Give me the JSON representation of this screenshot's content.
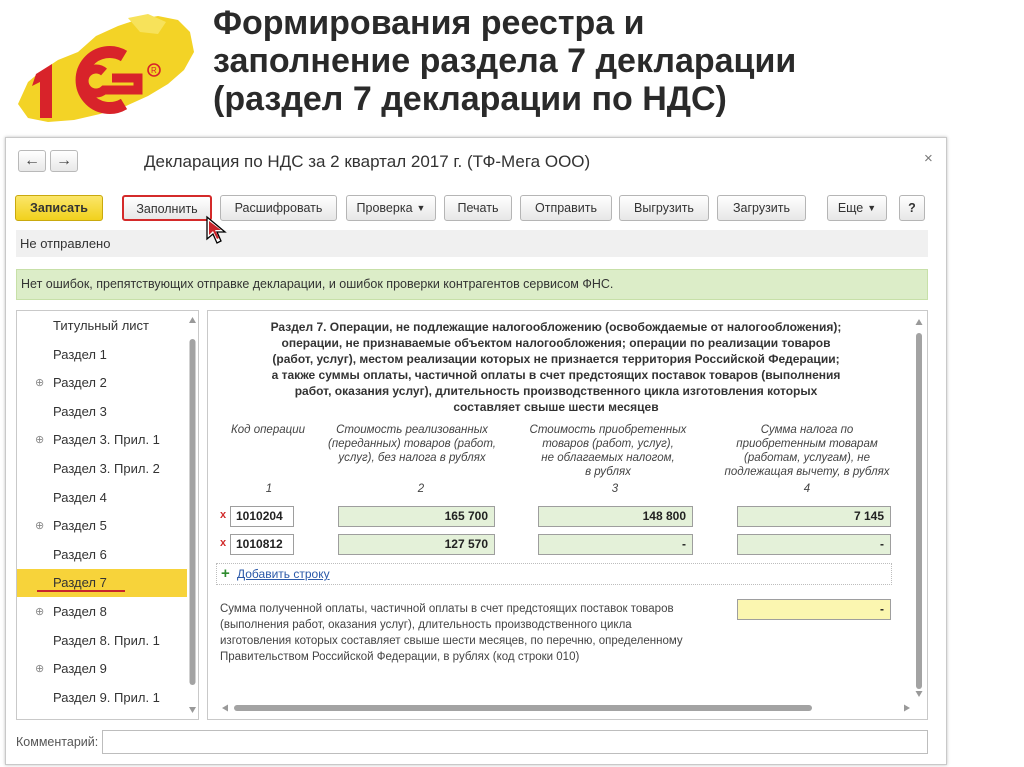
{
  "slide": {
    "title_lines": [
      "Формирования реестра и",
      "заполнение раздела 7 декларации",
      "(раздел 7 декларации по НДС)"
    ],
    "logo_text": "1С"
  },
  "window": {
    "title": "Декларация по НДС за 2 квартал 2017 г. (ТФ-Мега ООО)",
    "nav_back": "←",
    "nav_forward": "→",
    "close": "×"
  },
  "toolbar": {
    "save": "Записать",
    "fill": "Заполнить",
    "decode": "Расшифровать",
    "check": "Проверка",
    "print": "Печать",
    "send": "Отправить",
    "export": "Выгрузить",
    "import": "Загрузить",
    "more": "Еще",
    "help": "?"
  },
  "status": "Не отправлено",
  "info": "Нет ошибок, препятствующих отправке декларации, и ошибок проверки контрагентов сервисом ФНС.",
  "sidebar": {
    "items": [
      {
        "label": "Титульный лист",
        "expandable": false
      },
      {
        "label": "Раздел 1",
        "expandable": false
      },
      {
        "label": "Раздел 2",
        "expandable": true
      },
      {
        "label": "Раздел 3",
        "expandable": false
      },
      {
        "label": "Раздел 3. Прил. 1",
        "expandable": true
      },
      {
        "label": "Раздел 3. Прил. 2",
        "expandable": false
      },
      {
        "label": "Раздел 4",
        "expandable": false
      },
      {
        "label": "Раздел 5",
        "expandable": true
      },
      {
        "label": "Раздел 6",
        "expandable": false
      },
      {
        "label": "Раздел 7",
        "expandable": false,
        "active": true
      },
      {
        "label": "Раздел 8",
        "expandable": true
      },
      {
        "label": "Раздел 8. Прил. 1",
        "expandable": false
      },
      {
        "label": "Раздел 9",
        "expandable": true
      },
      {
        "label": "Раздел 9. Прил. 1",
        "expandable": false
      }
    ]
  },
  "section": {
    "heading_lines": [
      "Раздел 7. Операции, не подлежащие налогообложению (освобождаемые от налогообложения);",
      "операции, не признаваемые объектом налогообложения; операции по реализации товаров",
      "(работ, услуг), местом реализации которых не признается территория Российской Федерации;",
      "а также суммы оплаты, частичной оплаты в счет предстоящих поставок товаров (выполнения",
      "работ, оказания услуг), длительность производственного цикла изготовления которых",
      "составляет свыше шести месяцев"
    ],
    "columns": [
      {
        "title_lines": [
          "Код операции"
        ],
        "num": "1"
      },
      {
        "title_lines": [
          "Стоимость реализованных",
          "(переданных) товаров (работ,",
          "услуг), без налога в рублях"
        ],
        "num": "2"
      },
      {
        "title_lines": [
          "Стоимость приобретенных",
          "товаров (работ, услуг),",
          "не облагаемых налогом,",
          "в рублях"
        ],
        "num": "3"
      },
      {
        "title_lines": [
          "Сумма налога по",
          "приобретенным товарам",
          "(работам, услугам), не",
          "подлежащая вычету, в рублях"
        ],
        "num": "4"
      }
    ],
    "rows": [
      {
        "delete": "x",
        "code": "1010204",
        "c2": "165 700",
        "c3": "148 800",
        "c4": "7 145"
      },
      {
        "delete": "x",
        "code": "1010812",
        "c2": "127 570",
        "c3": "-",
        "c4": "-"
      }
    ],
    "add_row": "Добавить строку",
    "note_lines": [
      "Сумма полученной оплаты, частичной оплаты в счет предстоящих поставок товаров",
      "(выполнения работ, оказания услуг), длительность производственного цикла",
      "изготовления которых составляет свыше шести месяцев, по перечню, определенному",
      "Правительством Российской Федерации, в рублях (код строки 010)"
    ],
    "note_value": "-"
  },
  "comment": {
    "label": "Комментарий:",
    "value": ""
  },
  "colors": {
    "primary": "#f1d11c",
    "active_item": "#f7d33a",
    "info_bg": "#dcedc8",
    "cell_green": "#e4f1d9",
    "cell_yellow": "#fbf6b0",
    "highlight": "#d42a2a"
  }
}
